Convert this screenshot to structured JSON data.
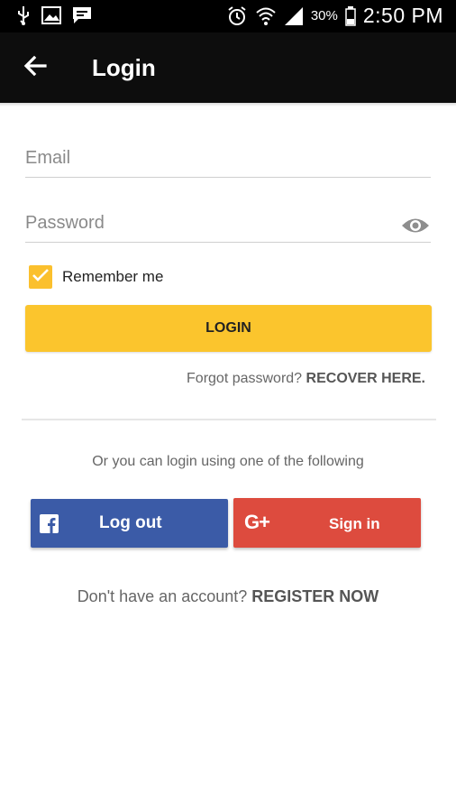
{
  "status_bar": {
    "battery": "30%",
    "time": "2:50 PM",
    "icons": [
      "usb-icon",
      "image-icon",
      "message-icon",
      "alarm-icon",
      "wifi-icon",
      "signal-icon",
      "battery-icon"
    ]
  },
  "app_bar": {
    "title": "Login",
    "back_icon": "arrow-left-icon"
  },
  "form": {
    "email_placeholder": "Email",
    "email_value": "",
    "password_placeholder": "Password",
    "password_value": "",
    "remember_label": "Remember me",
    "remember_checked": true,
    "login_label": "LOGIN"
  },
  "forgot": {
    "text": "Forgot password?",
    "link": "RECOVER HERE."
  },
  "social": {
    "intro": "Or you can login using one of the following",
    "facebook_label": "Log out",
    "google_label": "Sign in",
    "google_icon_text": "G+"
  },
  "register": {
    "text": "Don't have an account?",
    "link": "REGISTER NOW"
  },
  "colors": {
    "accent": "#fbc52d",
    "facebook": "#3b5ba7",
    "google": "#dd4b3e",
    "app_bar": "#0d0d0d"
  }
}
